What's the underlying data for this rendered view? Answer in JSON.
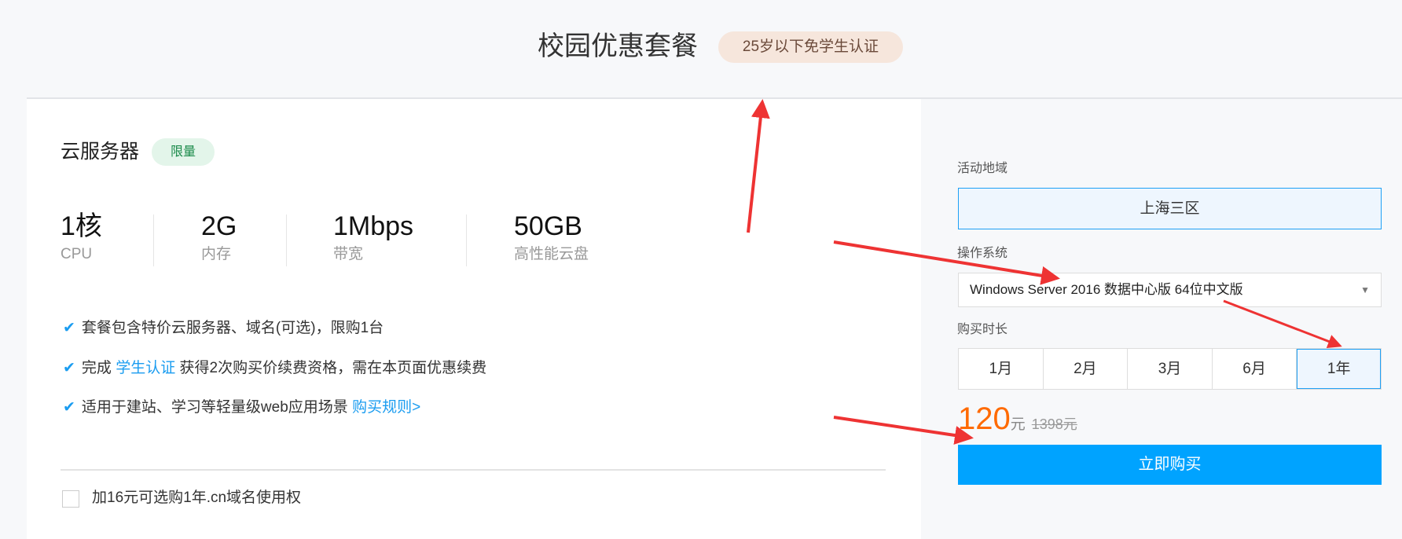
{
  "header": {
    "title": "校园优惠套餐",
    "badge": "25岁以下免学生认证"
  },
  "product": {
    "title": "云服务器",
    "badge": "限量",
    "specs": [
      {
        "value": "1核",
        "label": "CPU"
      },
      {
        "value": "2G",
        "label": "内存"
      },
      {
        "value": "1Mbps",
        "label": "带宽"
      },
      {
        "value": "50GB",
        "label": "高性能云盘"
      }
    ],
    "features": [
      {
        "text": "套餐包含特价云服务器、域名(可选)，限购1台"
      },
      {
        "pre": "完成 ",
        "link": "学生认证",
        "text": " 获得2次购买价续费资格，需在本页面优惠续费"
      },
      {
        "text": "适用于建站、学习等轻量级web应用场景 ",
        "link": "购买规则>"
      }
    ],
    "check_icon": "✔",
    "domain_option": {
      "label": "加16元可选购1年.cn域名使用权",
      "checked": false
    }
  },
  "order": {
    "region_label": "活动地域",
    "region": "上海三区",
    "os_label": "操作系统",
    "os": "Windows Server 2016 数据中心版 64位中文版",
    "os_arrow": "▼",
    "duration_label": "购买时长",
    "durations": [
      "1月",
      "2月",
      "3月",
      "6月",
      "1年"
    ],
    "selected_duration": "1年",
    "price": "120",
    "price_unit": "元",
    "original_price": "1398元",
    "buy_label": "立即购买"
  },
  "colors": {
    "accent": "#00a3ff",
    "price": "#ff6a00",
    "annotation": "#ee3333"
  }
}
